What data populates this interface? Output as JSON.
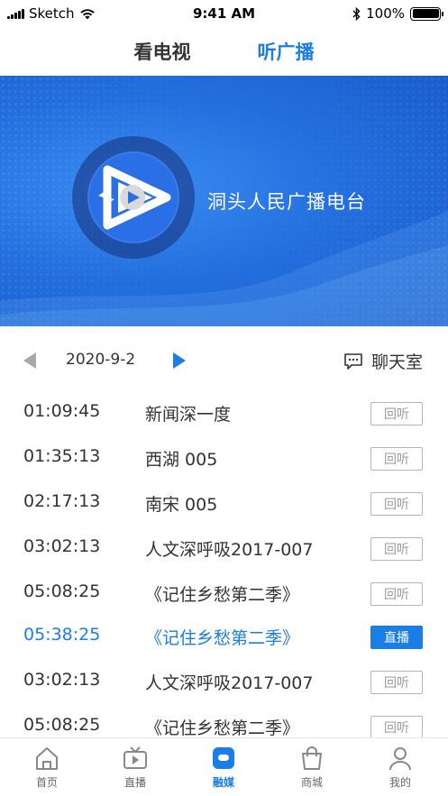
{
  "status_bar": {
    "carrier": "Sketch",
    "time": "9:41 AM",
    "battery": "100%"
  },
  "top_tabs": [
    {
      "label": "看电视",
      "active": false
    },
    {
      "label": "听广播",
      "active": true
    }
  ],
  "banner": {
    "station_name": "洞头人民广播电台"
  },
  "date_nav": {
    "date": "2020-9-2",
    "chat_label": "聊天室"
  },
  "programs": [
    {
      "time": "01:09:45",
      "title": "新闻深一度",
      "action": "回听"
    },
    {
      "time": "01:35:13",
      "title": "西湖 005",
      "action": "回听"
    },
    {
      "time": "02:17:13",
      "title": "南宋 005",
      "action": "回听"
    },
    {
      "time": "03:02:13",
      "title": "人文深呼吸2017-007",
      "action": "回听"
    },
    {
      "time": "05:08:25",
      "title": "《记住乡愁第二季》",
      "action": "回听"
    },
    {
      "time": "05:38:25",
      "title": "《记住乡愁第二季》",
      "action": "直播"
    },
    {
      "time": "03:02:13",
      "title": "人文深呼吸2017-007",
      "action": "回听"
    },
    {
      "time": "05:08:25",
      "title": "《记住乡愁第二季》",
      "action": "回听"
    }
  ],
  "bottom_nav": [
    {
      "label": "首页",
      "icon": "home-icon"
    },
    {
      "label": "直播",
      "icon": "tv-icon"
    },
    {
      "label": "融媒",
      "icon": "media-icon",
      "active": true
    },
    {
      "label": "商城",
      "icon": "shop-icon"
    },
    {
      "label": "我的",
      "icon": "profile-icon"
    }
  ],
  "colors": {
    "accent": "#1b7ee6",
    "banner": "#2370e0"
  }
}
